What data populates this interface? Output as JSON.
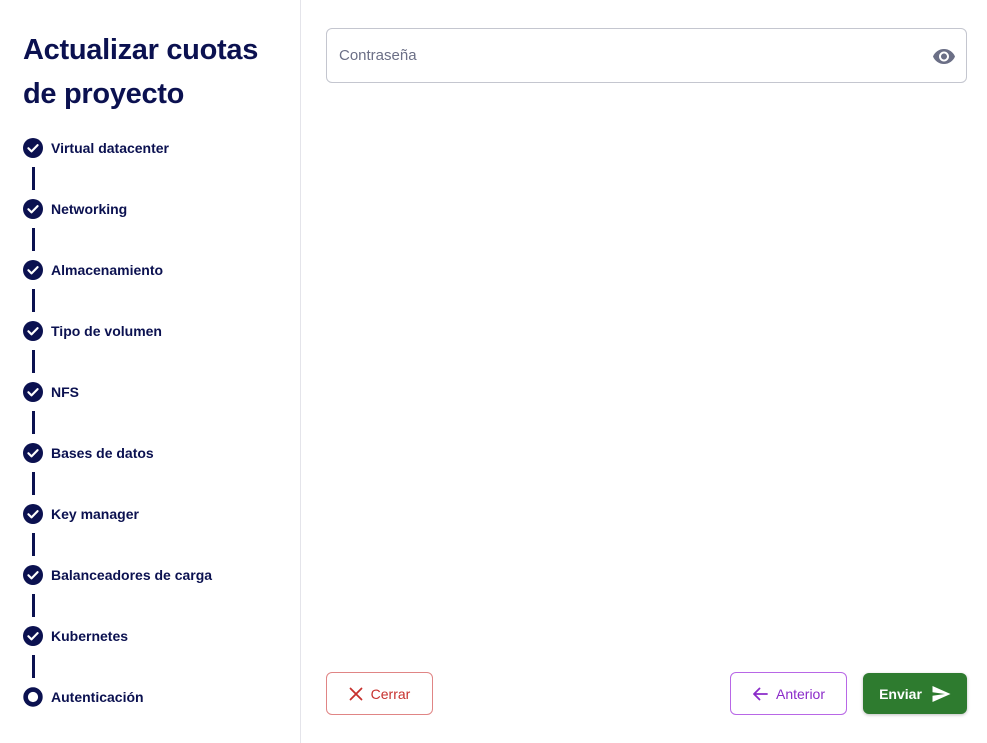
{
  "sidebar": {
    "title": "Actualizar cuotas de proyecto",
    "steps": [
      {
        "label": "Virtual datacenter",
        "status": "completed"
      },
      {
        "label": "Networking",
        "status": "completed"
      },
      {
        "label": "Almacenamiento",
        "status": "completed"
      },
      {
        "label": "Tipo de volumen",
        "status": "completed"
      },
      {
        "label": "NFS",
        "status": "completed"
      },
      {
        "label": "Bases de datos",
        "status": "completed"
      },
      {
        "label": "Key manager",
        "status": "completed"
      },
      {
        "label": "Balanceadores de carga",
        "status": "completed"
      },
      {
        "label": "Kubernetes",
        "status": "completed"
      },
      {
        "label": "Autenticación",
        "status": "current"
      }
    ]
  },
  "form": {
    "password": {
      "placeholder": "Contraseña",
      "value": "",
      "toggle_icon": "eye-icon"
    }
  },
  "actions": {
    "close_label": "Cerrar",
    "close_icon": "close-icon",
    "previous_label": "Anterior",
    "previous_icon": "arrow-left-icon",
    "submit_label": "Enviar",
    "submit_icon": "send-icon"
  },
  "colors": {
    "primary_text": "#0b1150",
    "close": "#c7302d",
    "previous": "#8b2bc9",
    "submit": "#2e7b2f"
  }
}
